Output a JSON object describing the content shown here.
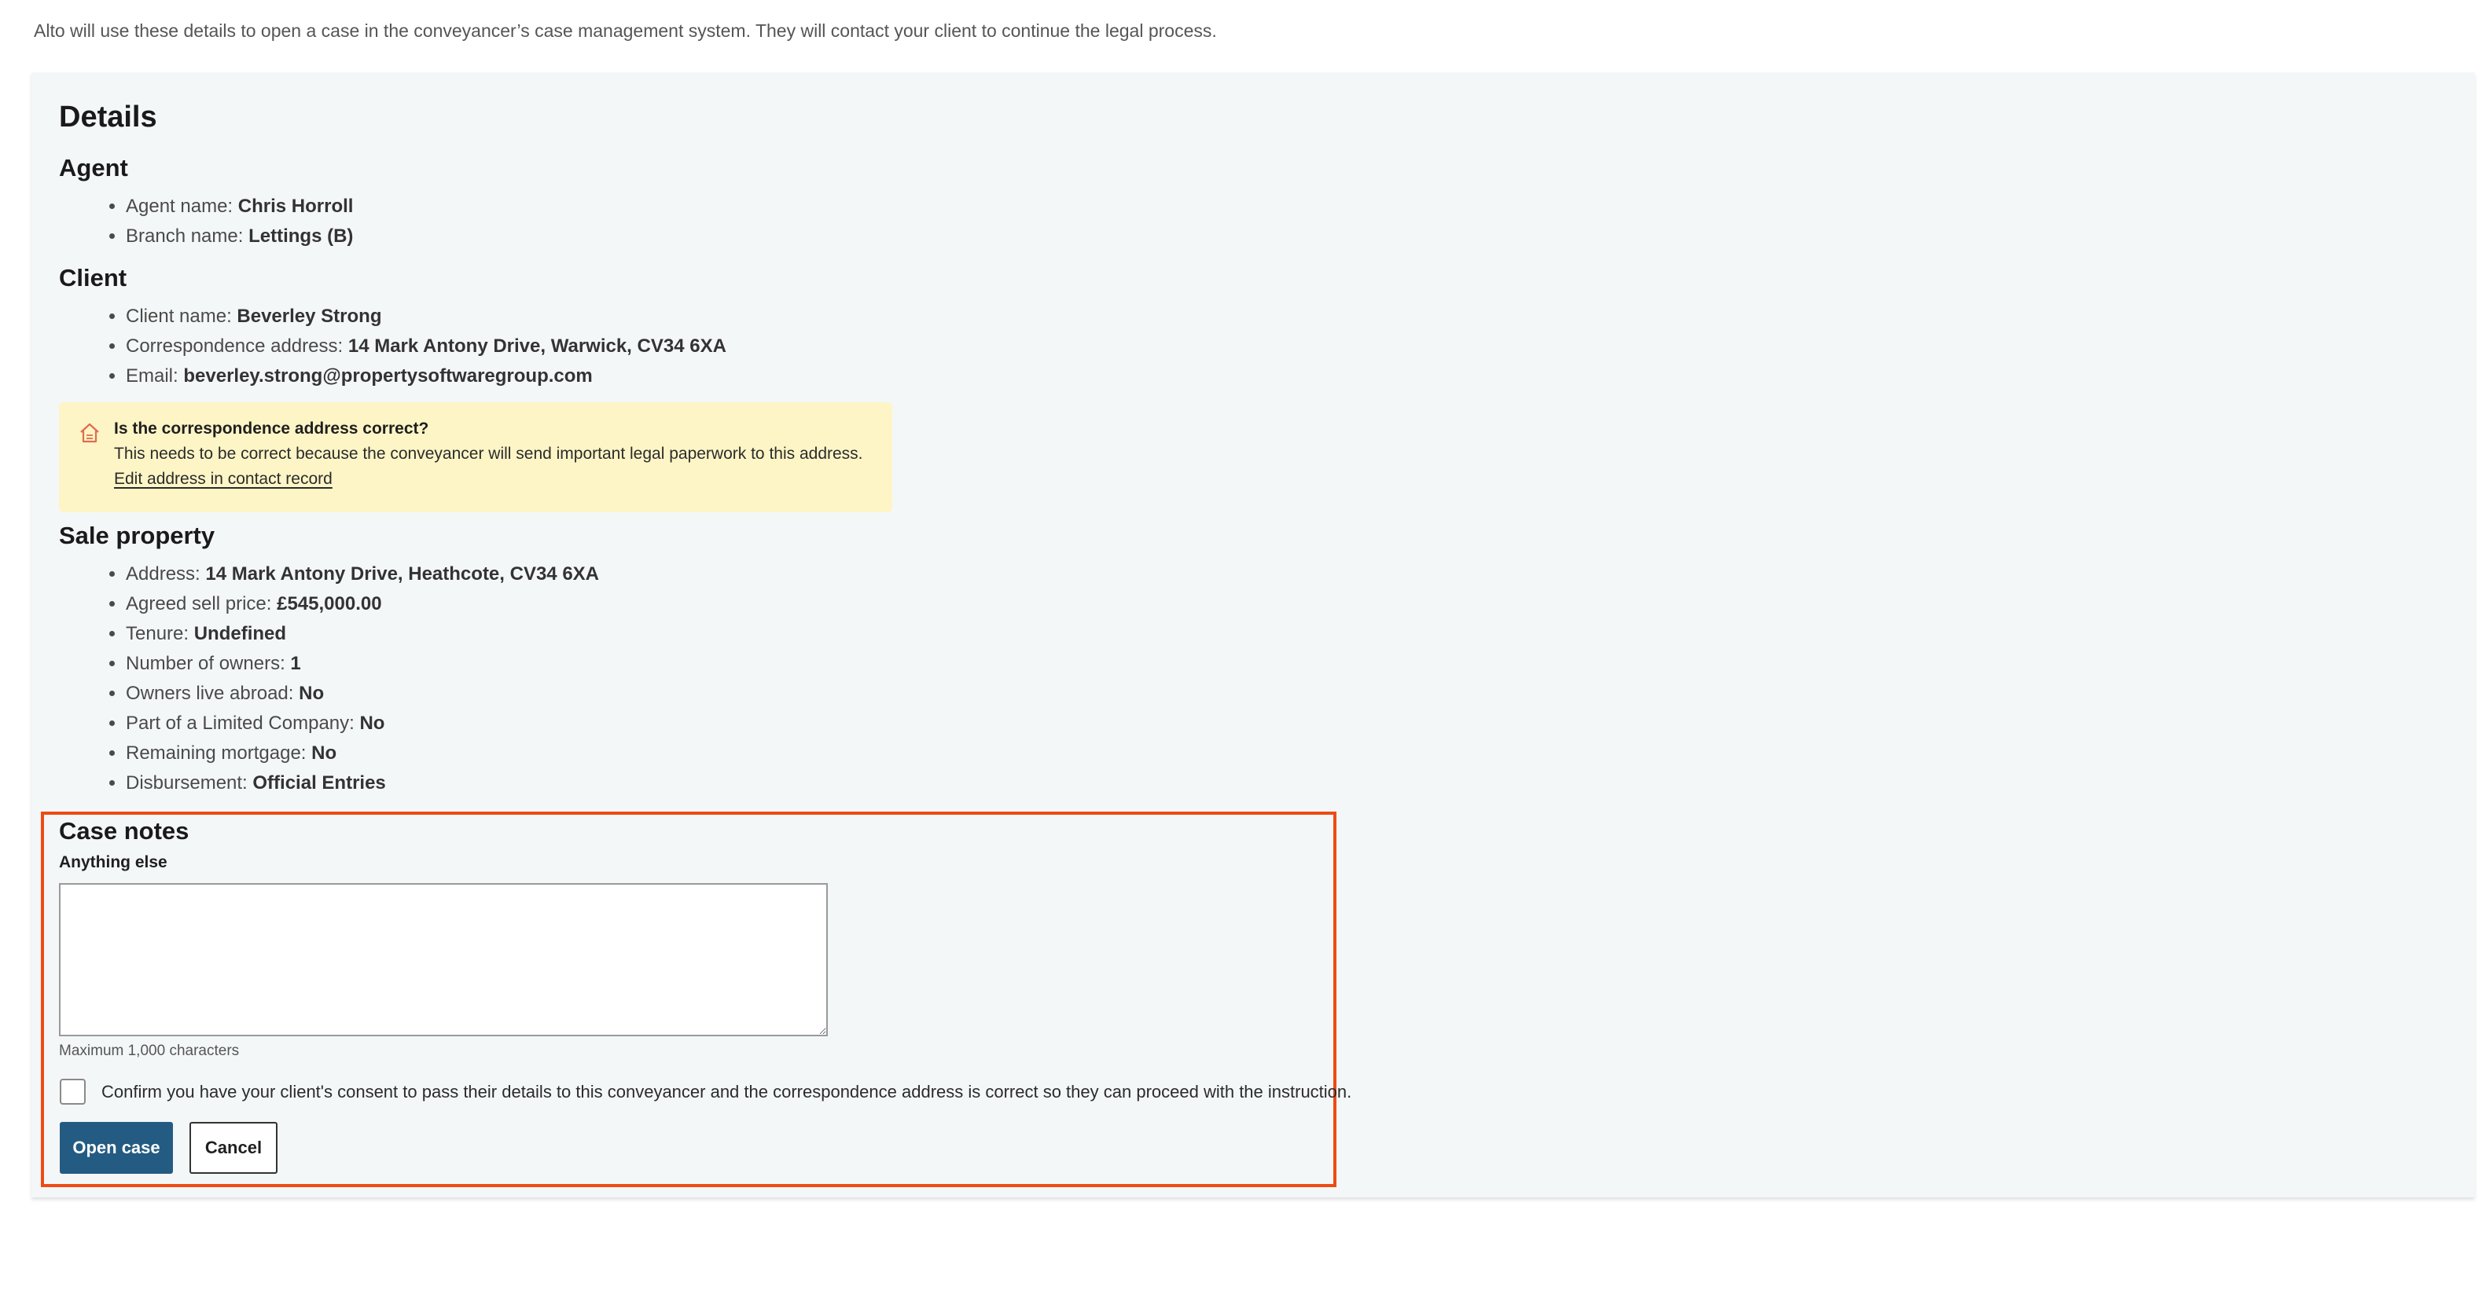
{
  "intro": "Alto will use these details to open a case in the conveyancer’s case management system. They will contact your client to continue the legal process.",
  "details": {
    "title": "Details",
    "agent": {
      "heading": "Agent",
      "items": [
        {
          "label": "Agent name: ",
          "value": "Chris Horroll"
        },
        {
          "label": "Branch name: ",
          "value": "Lettings (B)"
        }
      ]
    },
    "client": {
      "heading": "Client",
      "items": [
        {
          "label": "Client name: ",
          "value": "Beverley Strong"
        },
        {
          "label": "Correspondence address: ",
          "value": "14 Mark Antony Drive, Warwick, CV34 6XA"
        },
        {
          "label": "Email: ",
          "value": "beverley.strong@propertysoftwaregroup.com"
        }
      ]
    },
    "warning": {
      "icon": "house-warning-icon",
      "title": "Is the correspondence address correct?",
      "body": "This needs to be correct because the conveyancer will send important legal paperwork to this address.",
      "link": "Edit address in contact record",
      "color": "#fdf5c6"
    },
    "sale_property": {
      "heading": "Sale property",
      "items": [
        {
          "label": "Address: ",
          "value": "14 Mark Antony Drive, Heathcote, CV34 6XA"
        },
        {
          "label": "Agreed sell price: ",
          "value": "£545,000.00"
        },
        {
          "label": "Tenure: ",
          "value": "Undefined"
        },
        {
          "label": "Number of owners: ",
          "value": "1"
        },
        {
          "label": "Owners live abroad: ",
          "value": "No"
        },
        {
          "label": "Part of a Limited Company: ",
          "value": "No"
        },
        {
          "label": "Remaining mortgage: ",
          "value": "No"
        },
        {
          "label": "Disbursement: ",
          "value": "Official Entries"
        }
      ]
    }
  },
  "case_notes": {
    "heading": "Case notes",
    "field_label": "Anything else",
    "value": "",
    "hint": "Maximum 1,000 characters",
    "consent_text": "Confirm you have your client's consent to pass their details to this conveyancer and the correspondence address is correct so they can proceed with the instruction.",
    "consent_checked": false,
    "open_label": "Open case",
    "cancel_label": "Cancel"
  },
  "colors": {
    "primary": "#245b82",
    "highlight": "#ee4b14",
    "panel": "#f4f7f8"
  }
}
